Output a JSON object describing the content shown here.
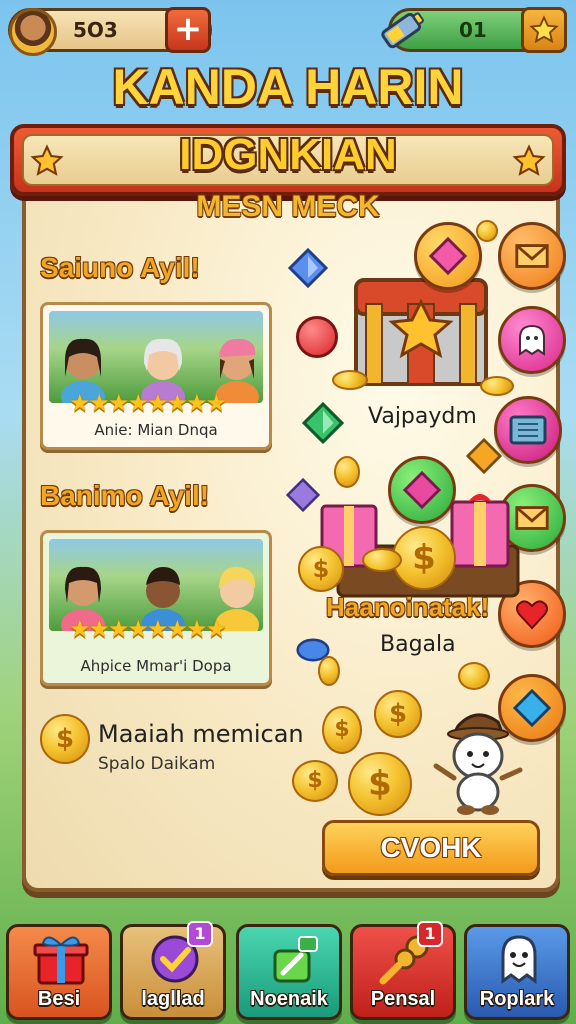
{
  "top_bar": {
    "left_counter": "5O3",
    "right_counter": "01"
  },
  "title": "KANDA HARIN",
  "banner_title": "IDGNKIAN",
  "subtitle": "MESN MECK",
  "sections": [
    {
      "heading": "Saiuno Ayil!",
      "caption": "Anie: Mian Dnqa",
      "stars": "★★★★★★★★"
    },
    {
      "heading": "Banimo Ayil!",
      "caption": "Ahpice Mmar'i Dopa",
      "stars": "★★★★★★★★"
    }
  ],
  "reward": {
    "title": "Maaiah memican",
    "subtitle": "Spalo Daikam"
  },
  "chest_label": "Vajpaydm",
  "treasure_label": "Haanoinatak!",
  "treasure_sublabel": "Bagala",
  "check_button": "CVOHK",
  "nav": [
    {
      "label": "Besi",
      "badge": "",
      "color": "#e8632e",
      "icon": "gift-icon"
    },
    {
      "label": "lagllad",
      "badge": "1",
      "color": "#b26fd6",
      "icon": "check-badge-icon"
    },
    {
      "label": "Noenaik",
      "badge": "",
      "color": "#27b38f",
      "icon": "hammer-icon"
    },
    {
      "label": "Pensal",
      "badge": "1",
      "color": "#d93a2c",
      "icon": "key-icon"
    },
    {
      "label": "Roplark",
      "badge": "",
      "color": "#3a7fd1",
      "icon": "ghost-icon"
    }
  ],
  "colors": {
    "title_gold": "#ffd43a",
    "banner_red": "#e4472a",
    "button_orange": "#f6b12e"
  }
}
